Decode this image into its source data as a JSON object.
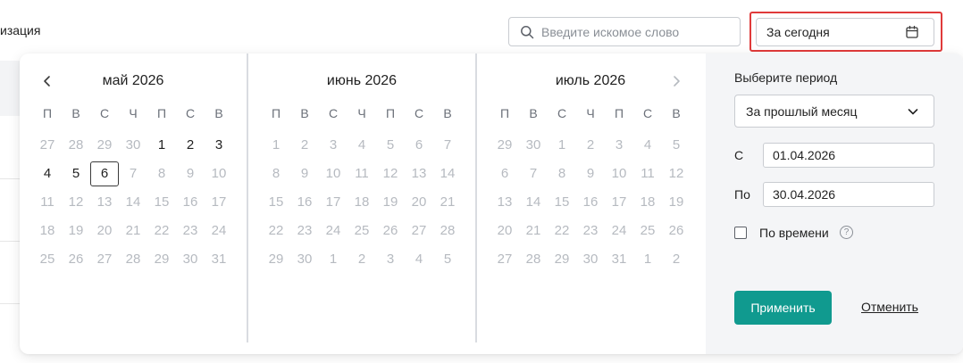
{
  "page": {
    "title_fragment": "изация"
  },
  "search": {
    "placeholder": "Введите искомое слово"
  },
  "date_filter": {
    "value": "За сегодня",
    "highlight_color": "#e03a3a"
  },
  "calendar": {
    "weekdays": [
      "П",
      "В",
      "С",
      "Ч",
      "П",
      "С",
      "В"
    ],
    "months": [
      {
        "title": "май 2026",
        "weeks": [
          [
            {
              "d": "27",
              "c": false
            },
            {
              "d": "28",
              "c": false
            },
            {
              "d": "29",
              "c": false
            },
            {
              "d": "30",
              "c": false
            },
            {
              "d": "1",
              "c": true
            },
            {
              "d": "2",
              "c": true
            },
            {
              "d": "3",
              "c": true
            }
          ],
          [
            {
              "d": "4",
              "c": true
            },
            {
              "d": "5",
              "c": true
            },
            {
              "d": "6",
              "c": true,
              "today": true
            },
            {
              "d": "7",
              "c": false
            },
            {
              "d": "8",
              "c": false
            },
            {
              "d": "9",
              "c": false
            },
            {
              "d": "10",
              "c": false
            }
          ],
          [
            {
              "d": "11",
              "c": false
            },
            {
              "d": "12",
              "c": false
            },
            {
              "d": "13",
              "c": false
            },
            {
              "d": "14",
              "c": false
            },
            {
              "d": "15",
              "c": false
            },
            {
              "d": "16",
              "c": false
            },
            {
              "d": "17",
              "c": false
            }
          ],
          [
            {
              "d": "18",
              "c": false
            },
            {
              "d": "19",
              "c": false
            },
            {
              "d": "20",
              "c": false
            },
            {
              "d": "21",
              "c": false
            },
            {
              "d": "22",
              "c": false
            },
            {
              "d": "23",
              "c": false
            },
            {
              "d": "24",
              "c": false
            }
          ],
          [
            {
              "d": "25",
              "c": false
            },
            {
              "d": "26",
              "c": false
            },
            {
              "d": "27",
              "c": false
            },
            {
              "d": "28",
              "c": false
            },
            {
              "d": "29",
              "c": false
            },
            {
              "d": "30",
              "c": false
            },
            {
              "d": "31",
              "c": false
            }
          ]
        ]
      },
      {
        "title": "июнь 2026",
        "weeks": [
          [
            {
              "d": "1",
              "c": false
            },
            {
              "d": "2",
              "c": false
            },
            {
              "d": "3",
              "c": false
            },
            {
              "d": "4",
              "c": false
            },
            {
              "d": "5",
              "c": false
            },
            {
              "d": "6",
              "c": false
            },
            {
              "d": "7",
              "c": false
            }
          ],
          [
            {
              "d": "8",
              "c": false
            },
            {
              "d": "9",
              "c": false
            },
            {
              "d": "10",
              "c": false
            },
            {
              "d": "11",
              "c": false
            },
            {
              "d": "12",
              "c": false
            },
            {
              "d": "13",
              "c": false
            },
            {
              "d": "14",
              "c": false
            }
          ],
          [
            {
              "d": "15",
              "c": false
            },
            {
              "d": "16",
              "c": false
            },
            {
              "d": "17",
              "c": false
            },
            {
              "d": "18",
              "c": false
            },
            {
              "d": "19",
              "c": false
            },
            {
              "d": "20",
              "c": false
            },
            {
              "d": "21",
              "c": false
            }
          ],
          [
            {
              "d": "22",
              "c": false
            },
            {
              "d": "23",
              "c": false
            },
            {
              "d": "24",
              "c": false
            },
            {
              "d": "25",
              "c": false
            },
            {
              "d": "26",
              "c": false
            },
            {
              "d": "27",
              "c": false
            },
            {
              "d": "28",
              "c": false
            }
          ],
          [
            {
              "d": "29",
              "c": false
            },
            {
              "d": "30",
              "c": false
            },
            {
              "d": "1",
              "c": false
            },
            {
              "d": "2",
              "c": false
            },
            {
              "d": "3",
              "c": false
            },
            {
              "d": "4",
              "c": false
            },
            {
              "d": "5",
              "c": false
            }
          ]
        ]
      },
      {
        "title": "июль 2026",
        "weeks": [
          [
            {
              "d": "29",
              "c": false
            },
            {
              "d": "30",
              "c": false
            },
            {
              "d": "1",
              "c": false
            },
            {
              "d": "2",
              "c": false
            },
            {
              "d": "3",
              "c": false
            },
            {
              "d": "4",
              "c": false
            },
            {
              "d": "5",
              "c": false
            }
          ],
          [
            {
              "d": "6",
              "c": false
            },
            {
              "d": "7",
              "c": false
            },
            {
              "d": "8",
              "c": false
            },
            {
              "d": "9",
              "c": false
            },
            {
              "d": "10",
              "c": false
            },
            {
              "d": "11",
              "c": false
            },
            {
              "d": "12",
              "c": false
            }
          ],
          [
            {
              "d": "13",
              "c": false
            },
            {
              "d": "14",
              "c": false
            },
            {
              "d": "15",
              "c": false
            },
            {
              "d": "16",
              "c": false
            },
            {
              "d": "17",
              "c": false
            },
            {
              "d": "18",
              "c": false
            },
            {
              "d": "19",
              "c": false
            }
          ],
          [
            {
              "d": "20",
              "c": false
            },
            {
              "d": "21",
              "c": false
            },
            {
              "d": "22",
              "c": false
            },
            {
              "d": "23",
              "c": false
            },
            {
              "d": "24",
              "c": false
            },
            {
              "d": "25",
              "c": false
            },
            {
              "d": "26",
              "c": false
            }
          ],
          [
            {
              "d": "27",
              "c": false
            },
            {
              "d": "28",
              "c": false
            },
            {
              "d": "29",
              "c": false
            },
            {
              "d": "30",
              "c": false
            },
            {
              "d": "31",
              "c": false
            },
            {
              "d": "1",
              "c": false
            },
            {
              "d": "2",
              "c": false
            }
          ]
        ]
      }
    ]
  },
  "period": {
    "title": "Выберите период",
    "selected": "За прошлый месяц",
    "from_label": "С",
    "from_value": "01.04.2026",
    "to_label": "По",
    "to_value": "30.04.2026",
    "by_time_label": "По времени",
    "by_time_checked": false,
    "help_glyph": "?",
    "apply_label": "Применить",
    "cancel_label": "Отменить",
    "apply_color": "#109a8f"
  }
}
